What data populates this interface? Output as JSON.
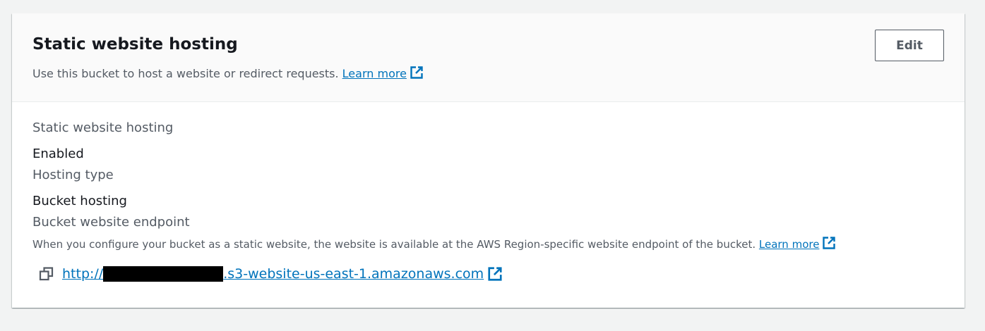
{
  "header": {
    "title": "Static website hosting",
    "description": "Use this bucket to host a website or redirect requests.",
    "learn_more": "Learn more",
    "edit_label": "Edit"
  },
  "body": {
    "hosting_label": "Static website hosting",
    "hosting_value": "Enabled",
    "type_label": "Hosting type",
    "type_value": "Bucket hosting",
    "endpoint_label": "Bucket website endpoint",
    "endpoint_hint": "When you configure your bucket as a static website, the website is available at the AWS Region-specific website endpoint of the bucket.",
    "learn_more": "Learn more",
    "endpoint_prefix": "http://",
    "endpoint_suffix": ".s3-website-us-east-1.amazonaws.com"
  },
  "icons": {
    "external": "external-link-icon",
    "copy": "copy-icon"
  },
  "colors": {
    "link": "#0073bb",
    "text": "#16191f",
    "muted": "#545b64",
    "background": "#f2f3f3"
  }
}
